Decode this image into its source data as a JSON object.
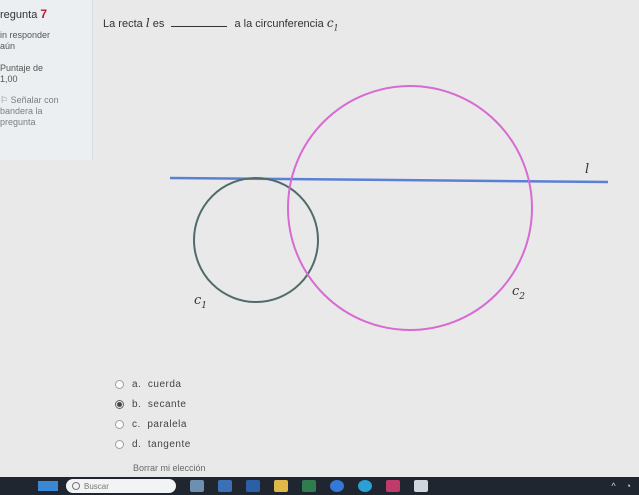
{
  "sidebar": {
    "question_prefix": "regunta",
    "question_number": "7",
    "status_lines": [
      "in responder",
      "aún"
    ],
    "score_lines": [
      "Puntaje de",
      "1,00"
    ],
    "flag_lines": [
      "Señalar con",
      "bandera la",
      "pregunta"
    ]
  },
  "question": {
    "prefix": "La recta",
    "line_symbol": "l",
    "after_symbol": " es",
    "suffix": "a la circunferencia",
    "circle_symbol": "c",
    "circle_sub": "1"
  },
  "figure": {
    "line_label": "l",
    "c1_label": "c",
    "c1_sub": "1",
    "c2_label": "c",
    "c2_sub": "2",
    "colors": {
      "line": "#5b7fd4",
      "circle1": "#4f6b6b",
      "circle2": "#d66bd2"
    }
  },
  "options": [
    {
      "letter": "a.",
      "text": "cuerda",
      "selected": false
    },
    {
      "letter": "b.",
      "text": "secante",
      "selected": true
    },
    {
      "letter": "c.",
      "text": "paralela",
      "selected": false
    },
    {
      "letter": "d.",
      "text": "tangente",
      "selected": false
    }
  ],
  "clear_choice": "Borrar mi elección",
  "taskbar": {
    "search_placeholder": "Buscar",
    "icons": [
      "windows-icon",
      "search-icon",
      "app-icon",
      "app-icon",
      "app-icon",
      "folder-icon",
      "app-icon",
      "help-icon",
      "chrome-icon",
      "app-icon",
      "app-icon"
    ],
    "tray": [
      "^",
      "wifi"
    ]
  }
}
